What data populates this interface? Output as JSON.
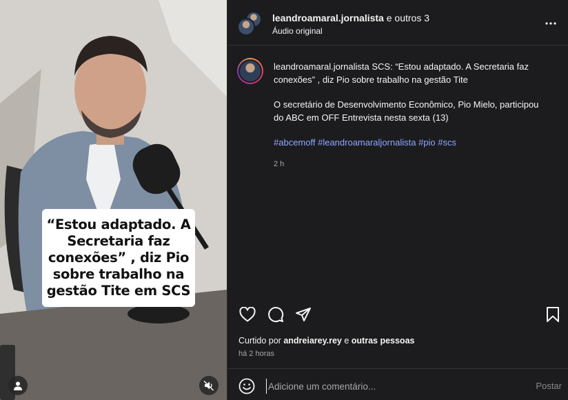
{
  "media": {
    "overlay_caption": "“Estou adaptado. A Secretaria faz conexões” , diz Pio sobre trabalho na gestão Tite em SCS",
    "user_icon": "user-icon",
    "mute_icon": "speaker-muted-icon"
  },
  "header": {
    "username": "leandroamaral.jornalista",
    "others_text": " e outros 3",
    "subtitle": "Áudio original",
    "more_icon": "more-horizontal-icon"
  },
  "post": {
    "username": "leandroamaral.jornalista",
    "title_text": " SCS: “Estou adaptado. A Secretaria faz conexões” , diz Pio sobre trabalho na gestão Tite",
    "body": "O secretário de Desenvolvimento Econômico, Pio Mielo, participou do ABC em OFF Entrevista nesta sexta (13)",
    "hashtags": [
      "#abcemoff",
      "#leandroamaraljornalista",
      "#pio",
      "#scs"
    ],
    "time": "2 h"
  },
  "actions": {
    "like_icon": "heart-icon",
    "comment_icon": "comment-icon",
    "share_icon": "send-icon",
    "save_icon": "bookmark-icon"
  },
  "likes": {
    "prefix": "Curtido por ",
    "user": "andreiarey.rey",
    "middle": " e ",
    "others": "outras pessoas"
  },
  "posted_ago": "há 2 horas",
  "comment": {
    "placeholder": "Adicione um comentário...",
    "post_label": "Postar",
    "emoji_icon": "emoji-icon"
  },
  "colors": {
    "panel_bg": "#1c1c1e",
    "text": "#f5f5f5",
    "muted": "#a8a8a8",
    "hashtag": "#8ea7ff",
    "divider": "#363636"
  }
}
